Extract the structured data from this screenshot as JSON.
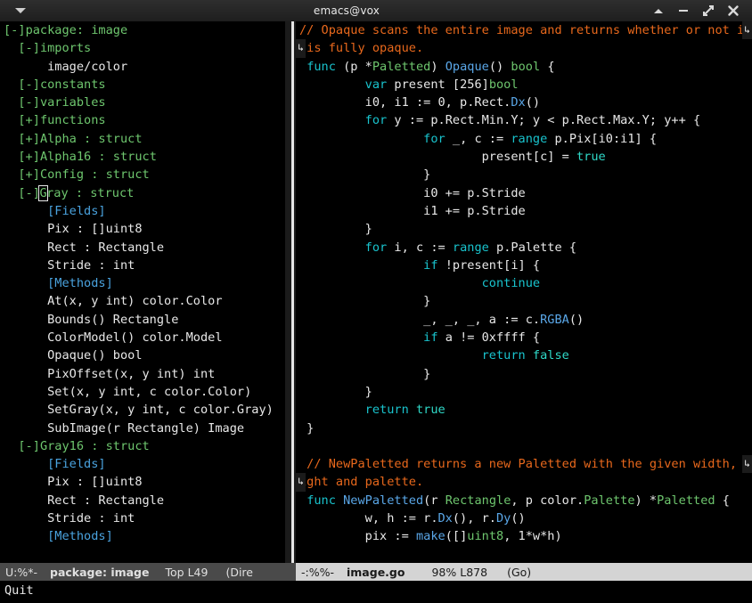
{
  "window": {
    "title": "emacs@vox",
    "menu_icon": "triangle-down-icon",
    "controls": [
      {
        "name": "shade-button",
        "icon": "chevron-up-icon",
        "label": "▲"
      },
      {
        "name": "minimize-button",
        "icon": "minus-icon",
        "label": "–"
      },
      {
        "name": "maximize-button",
        "icon": "expand-arrows-icon",
        "label": "⤢"
      },
      {
        "name": "close-button",
        "icon": "close-x-icon",
        "label": "✕"
      }
    ]
  },
  "colors": {
    "titlebar_bg": "#2e2e2e",
    "pane_bg": "#000000",
    "keyword": "#19c3cd",
    "type": "#6ec66e",
    "function": "#5aa7e8",
    "comment": "#e8681c",
    "literal": "#2fd9c8",
    "plain": "#e8e8e8",
    "tree_node": "#6ec66e",
    "tree_section": "#4aa3df",
    "modeline_active_bg": "#d4d4d4",
    "modeline_inactive_bg": "#4a4a4a"
  },
  "left_pane": {
    "buffer_name": "package: image",
    "tree": [
      {
        "indent": 0,
        "marker": "[-]",
        "text": "package: image",
        "kind": "node"
      },
      {
        "indent": 1,
        "marker": "[-]",
        "text": "imports",
        "kind": "node"
      },
      {
        "indent": 3,
        "marker": "",
        "text": "image/color",
        "kind": "leaf"
      },
      {
        "indent": 1,
        "marker": "[-]",
        "text": "constants",
        "kind": "node"
      },
      {
        "indent": 1,
        "marker": "[-]",
        "text": "variables",
        "kind": "node"
      },
      {
        "indent": 1,
        "marker": "[+]",
        "text": "functions",
        "kind": "node"
      },
      {
        "indent": 1,
        "marker": "[+]",
        "text": "Alpha : struct",
        "kind": "node"
      },
      {
        "indent": 1,
        "marker": "[+]",
        "text": "Alpha16 : struct",
        "kind": "node"
      },
      {
        "indent": 1,
        "marker": "[+]",
        "text": "Config : struct",
        "kind": "node"
      },
      {
        "indent": 1,
        "marker": "[-]",
        "text": "Gray : struct",
        "kind": "node",
        "cursor": true
      },
      {
        "indent": 3,
        "marker": "",
        "text": "[Fields]",
        "kind": "section"
      },
      {
        "indent": 3,
        "marker": "",
        "text": "Pix : []uint8",
        "kind": "leaf"
      },
      {
        "indent": 3,
        "marker": "",
        "text": "Rect : Rectangle",
        "kind": "leaf"
      },
      {
        "indent": 3,
        "marker": "",
        "text": "Stride : int",
        "kind": "leaf"
      },
      {
        "indent": 3,
        "marker": "",
        "text": "[Methods]",
        "kind": "section"
      },
      {
        "indent": 3,
        "marker": "",
        "text": "At(x, y int) color.Color",
        "kind": "leaf"
      },
      {
        "indent": 3,
        "marker": "",
        "text": "Bounds() Rectangle",
        "kind": "leaf"
      },
      {
        "indent": 3,
        "marker": "",
        "text": "ColorModel() color.Model",
        "kind": "leaf"
      },
      {
        "indent": 3,
        "marker": "",
        "text": "Opaque() bool",
        "kind": "leaf"
      },
      {
        "indent": 3,
        "marker": "",
        "text": "PixOffset(x, y int) int",
        "kind": "leaf"
      },
      {
        "indent": 3,
        "marker": "",
        "text": "Set(x, y int, c color.Color)",
        "kind": "leaf"
      },
      {
        "indent": 3,
        "marker": "",
        "text": "SetGray(x, y int, c color.Gray)",
        "kind": "leaf"
      },
      {
        "indent": 3,
        "marker": "",
        "text": "SubImage(r Rectangle) Image",
        "kind": "leaf"
      },
      {
        "indent": 1,
        "marker": "[-]",
        "text": "Gray16 : struct",
        "kind": "node"
      },
      {
        "indent": 3,
        "marker": "",
        "text": "[Fields]",
        "kind": "section"
      },
      {
        "indent": 3,
        "marker": "",
        "text": "Pix : []uint8",
        "kind": "leaf"
      },
      {
        "indent": 3,
        "marker": "",
        "text": "Rect : Rectangle",
        "kind": "leaf"
      },
      {
        "indent": 3,
        "marker": "",
        "text": "Stride : int",
        "kind": "leaf"
      },
      {
        "indent": 3,
        "marker": "",
        "text": "[Methods]",
        "kind": "section"
      }
    ]
  },
  "right_pane": {
    "buffer_name": "image.go",
    "code_lines": [
      {
        "wrap_right": true,
        "tokens": [
          {
            "t": "// Opaque scans the entire image and returns whether or not it",
            "c": "cm"
          }
        ]
      },
      {
        "wrap_left": true,
        "tokens": [
          {
            "t": " is fully opaque.",
            "c": "cm"
          }
        ]
      },
      {
        "tokens": [
          {
            "t": " ",
            "c": "pl"
          },
          {
            "t": "func",
            "c": "kw"
          },
          {
            "t": " (p *",
            "c": "pl"
          },
          {
            "t": "Paletted",
            "c": "typ"
          },
          {
            "t": ") ",
            "c": "pl"
          },
          {
            "t": "Opaque",
            "c": "fn"
          },
          {
            "t": "() ",
            "c": "pl"
          },
          {
            "t": "bool",
            "c": "typ"
          },
          {
            "t": " {",
            "c": "pl"
          }
        ]
      },
      {
        "tokens": [
          {
            "t": "         ",
            "c": "pl"
          },
          {
            "t": "var",
            "c": "kw"
          },
          {
            "t": " present [256]",
            "c": "pl"
          },
          {
            "t": "bool",
            "c": "typ"
          }
        ]
      },
      {
        "tokens": [
          {
            "t": "         i0, i1 := 0, p.",
            "c": "pl"
          },
          {
            "t": "Rect",
            "c": "pl"
          },
          {
            "t": ".",
            "c": "pl"
          },
          {
            "t": "Dx",
            "c": "fn"
          },
          {
            "t": "()",
            "c": "pl"
          }
        ]
      },
      {
        "tokens": [
          {
            "t": "         ",
            "c": "pl"
          },
          {
            "t": "for",
            "c": "kw"
          },
          {
            "t": " y := p.Rect.Min.Y; y < p.Rect.Max.Y; y++ {",
            "c": "pl"
          }
        ]
      },
      {
        "tokens": [
          {
            "t": "                 ",
            "c": "pl"
          },
          {
            "t": "for",
            "c": "kw"
          },
          {
            "t": " _, c := ",
            "c": "pl"
          },
          {
            "t": "range",
            "c": "kw"
          },
          {
            "t": " p.Pix[i0:i1] {",
            "c": "pl"
          }
        ]
      },
      {
        "tokens": [
          {
            "t": "                         present[c] = ",
            "c": "pl"
          },
          {
            "t": "true",
            "c": "lit"
          }
        ]
      },
      {
        "tokens": [
          {
            "t": "                 }",
            "c": "pl"
          }
        ]
      },
      {
        "tokens": [
          {
            "t": "                 i0 += p.Stride",
            "c": "pl"
          }
        ]
      },
      {
        "tokens": [
          {
            "t": "                 i1 += p.Stride",
            "c": "pl"
          }
        ]
      },
      {
        "tokens": [
          {
            "t": "         }",
            "c": "pl"
          }
        ]
      },
      {
        "tokens": [
          {
            "t": "         ",
            "c": "pl"
          },
          {
            "t": "for",
            "c": "kw"
          },
          {
            "t": " i, c := ",
            "c": "pl"
          },
          {
            "t": "range",
            "c": "kw"
          },
          {
            "t": " p.Palette {",
            "c": "pl"
          }
        ]
      },
      {
        "tokens": [
          {
            "t": "                 ",
            "c": "pl"
          },
          {
            "t": "if",
            "c": "kw"
          },
          {
            "t": " !present[i] {",
            "c": "pl"
          }
        ]
      },
      {
        "tokens": [
          {
            "t": "                         ",
            "c": "pl"
          },
          {
            "t": "continue",
            "c": "kw"
          }
        ]
      },
      {
        "tokens": [
          {
            "t": "                 }",
            "c": "pl"
          }
        ]
      },
      {
        "tokens": [
          {
            "t": "                 _, _, _, a := c.",
            "c": "pl"
          },
          {
            "t": "RGBA",
            "c": "fn"
          },
          {
            "t": "()",
            "c": "pl"
          }
        ]
      },
      {
        "tokens": [
          {
            "t": "                 ",
            "c": "pl"
          },
          {
            "t": "if",
            "c": "kw"
          },
          {
            "t": " a != 0xffff {",
            "c": "pl"
          }
        ]
      },
      {
        "tokens": [
          {
            "t": "                         ",
            "c": "pl"
          },
          {
            "t": "return",
            "c": "kw"
          },
          {
            "t": " ",
            "c": "pl"
          },
          {
            "t": "false",
            "c": "lit"
          }
        ]
      },
      {
        "tokens": [
          {
            "t": "                 }",
            "c": "pl"
          }
        ]
      },
      {
        "tokens": [
          {
            "t": "         }",
            "c": "pl"
          }
        ]
      },
      {
        "tokens": [
          {
            "t": "         ",
            "c": "pl"
          },
          {
            "t": "return",
            "c": "kw"
          },
          {
            "t": " ",
            "c": "pl"
          },
          {
            "t": "true",
            "c": "lit"
          }
        ]
      },
      {
        "tokens": [
          {
            "t": " }",
            "c": "pl"
          }
        ]
      },
      {
        "tokens": [
          {
            "t": "",
            "c": "pl"
          }
        ]
      },
      {
        "wrap_right": true,
        "tokens": [
          {
            "t": " // NewPaletted returns a new Paletted with the given width, he",
            "c": "cm"
          }
        ]
      },
      {
        "wrap_left": true,
        "tokens": [
          {
            "t": "ight and palette.",
            "c": "cm"
          }
        ]
      },
      {
        "tokens": [
          {
            "t": " ",
            "c": "pl"
          },
          {
            "t": "func",
            "c": "kw"
          },
          {
            "t": " ",
            "c": "pl"
          },
          {
            "t": "NewPaletted",
            "c": "fn"
          },
          {
            "t": "(r ",
            "c": "pl"
          },
          {
            "t": "Rectangle",
            "c": "typ"
          },
          {
            "t": ", p color.",
            "c": "pl"
          },
          {
            "t": "Palette",
            "c": "typ"
          },
          {
            "t": ") *",
            "c": "pl"
          },
          {
            "t": "Paletted",
            "c": "typ"
          },
          {
            "t": " {",
            "c": "pl"
          }
        ]
      },
      {
        "tokens": [
          {
            "t": "         w, h := r.",
            "c": "pl"
          },
          {
            "t": "Dx",
            "c": "fn"
          },
          {
            "t": "(), r.",
            "c": "pl"
          },
          {
            "t": "Dy",
            "c": "fn"
          },
          {
            "t": "()",
            "c": "pl"
          }
        ]
      },
      {
        "tokens": [
          {
            "t": "         pix := ",
            "c": "pl"
          },
          {
            "t": "make",
            "c": "fn"
          },
          {
            "t": "([]",
            "c": "pl"
          },
          {
            "t": "uint8",
            "c": "typ"
          },
          {
            "t": ", 1*w*h)",
            "c": "pl"
          }
        ]
      }
    ]
  },
  "modeline_left": {
    "flags": "U:%*-",
    "buffer": "package: image",
    "position": "Top L49",
    "mode": "(Dire"
  },
  "modeline_right": {
    "flags": "-:%%-",
    "buffer": "image.go",
    "position": "98% L878",
    "mode": "(Go)"
  },
  "minibuffer": {
    "text": "Quit"
  }
}
